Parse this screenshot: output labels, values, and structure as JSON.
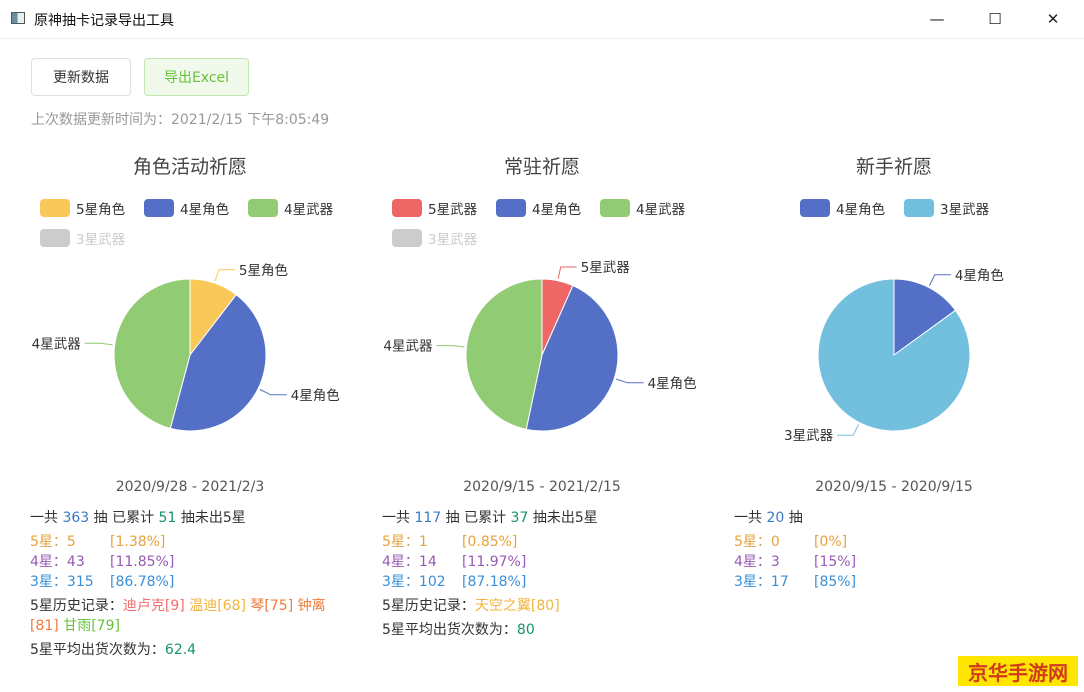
{
  "window": {
    "title": "原神抽卡记录导出工具",
    "minimize": "—",
    "maximize": "☐",
    "close": "✕"
  },
  "toolbar": {
    "refresh_label": "更新数据",
    "export_label": "导出Excel"
  },
  "update_time": "上次数据更新时间为：2021/2/15 下午8:05:49",
  "colors": {
    "five_role": "#f9c858",
    "four_role": "#5470c6",
    "four_weapon": "#91cc75",
    "three_weapon": "#73c0de",
    "five_weapon": "#ee6666",
    "disabled": "#cccccc"
  },
  "pools": [
    {
      "title": "角色活动祈愿",
      "legend": [
        {
          "label": "5星角色",
          "color": "#f9c858",
          "off": false
        },
        {
          "label": "4星角色",
          "color": "#5470c6",
          "off": false
        },
        {
          "label": "4星武器",
          "color": "#91cc75",
          "off": false
        },
        {
          "label": "3星武器",
          "color": "#cccccc",
          "off": true
        }
      ],
      "date_start": "2020/9/28",
      "date_sep": "-",
      "date_end": "2021/2/3",
      "summary": {
        "prefix": "一共",
        "total": "363",
        "mid": "抽  已累计",
        "since": "51",
        "suffix": "抽未出5星"
      },
      "star5": {
        "label": "5星：",
        "count": "5",
        "pct": "[1.38%]"
      },
      "star4": {
        "label": "4星：",
        "count": "43",
        "pct": "[11.85%]"
      },
      "star3": {
        "label": "3星：",
        "count": "315",
        "pct": "[86.78%]"
      },
      "history_label": "5星历史记录：",
      "history": [
        {
          "text": "迪卢克[9]",
          "cls": "hist-name-red"
        },
        {
          "text": "温迪[68]",
          "cls": "hist-name-yellow"
        },
        {
          "text": "琴[75]",
          "cls": "hist-name-orange"
        },
        {
          "text": "钟离[81]",
          "cls": "hist-name-orange"
        },
        {
          "text": "甘雨[79]",
          "cls": "hist-name-green"
        }
      ],
      "avg_label": "5星平均出货次数为：",
      "avg": "62.4"
    },
    {
      "title": "常驻祈愿",
      "legend": [
        {
          "label": "5星武器",
          "color": "#ee6666",
          "off": false
        },
        {
          "label": "4星角色",
          "color": "#5470c6",
          "off": false
        },
        {
          "label": "4星武器",
          "color": "#91cc75",
          "off": false
        },
        {
          "label": "3星武器",
          "color": "#cccccc",
          "off": true
        }
      ],
      "date_start": "2020/9/15",
      "date_sep": "-",
      "date_end": "2021/2/15",
      "summary": {
        "prefix": "一共",
        "total": "117",
        "mid": "抽  已累计",
        "since": "37",
        "suffix": "抽未出5星"
      },
      "star5": {
        "label": "5星：",
        "count": "1",
        "pct": "[0.85%]"
      },
      "star4": {
        "label": "4星：",
        "count": "14",
        "pct": "[11.97%]"
      },
      "star3": {
        "label": "3星：",
        "count": "102",
        "pct": "[87.18%]"
      },
      "history_label": "5星历史记录：",
      "history": [
        {
          "text": "天空之翼[80]",
          "cls": "hist-name-yellow"
        }
      ],
      "avg_label": "5星平均出货次数为：",
      "avg": "80"
    },
    {
      "title": "新手祈愿",
      "legend": [
        {
          "label": "4星角色",
          "color": "#5470c6",
          "off": false
        },
        {
          "label": "3星武器",
          "color": "#73c0de",
          "off": false
        }
      ],
      "date_start": "2020/9/15",
      "date_sep": "-",
      "date_end": "2020/9/15",
      "summary": {
        "prefix": "一共",
        "total": "20",
        "mid": "抽",
        "since": "",
        "suffix": ""
      },
      "star5": {
        "label": "5星：",
        "count": "0",
        "pct": "[0%]"
      },
      "star4": {
        "label": "4星：",
        "count": "3",
        "pct": "[15%]"
      },
      "star3": {
        "label": "3星：",
        "count": "17",
        "pct": "[85%]"
      },
      "history_label": "",
      "history": [],
      "avg_label": "",
      "avg": ""
    }
  ],
  "chart_data": [
    {
      "type": "pie",
      "title": "角色活动祈愿",
      "labels": [
        "5星角色",
        "4星角色",
        "4星武器"
      ],
      "values": [
        5,
        21,
        22
      ],
      "colors": [
        "#f9c858",
        "#5470c6",
        "#91cc75"
      ]
    },
    {
      "type": "pie",
      "title": "常驻祈愿",
      "labels": [
        "5星武器",
        "4星角色",
        "4星武器"
      ],
      "values": [
        1,
        7,
        7
      ],
      "colors": [
        "#ee6666",
        "#5470c6",
        "#91cc75"
      ]
    },
    {
      "type": "pie",
      "title": "新手祈愿",
      "labels": [
        "4星角色",
        "3星武器"
      ],
      "values": [
        3,
        17
      ],
      "colors": [
        "#5470c6",
        "#73c0de"
      ]
    }
  ],
  "watermark": "京华手游网"
}
